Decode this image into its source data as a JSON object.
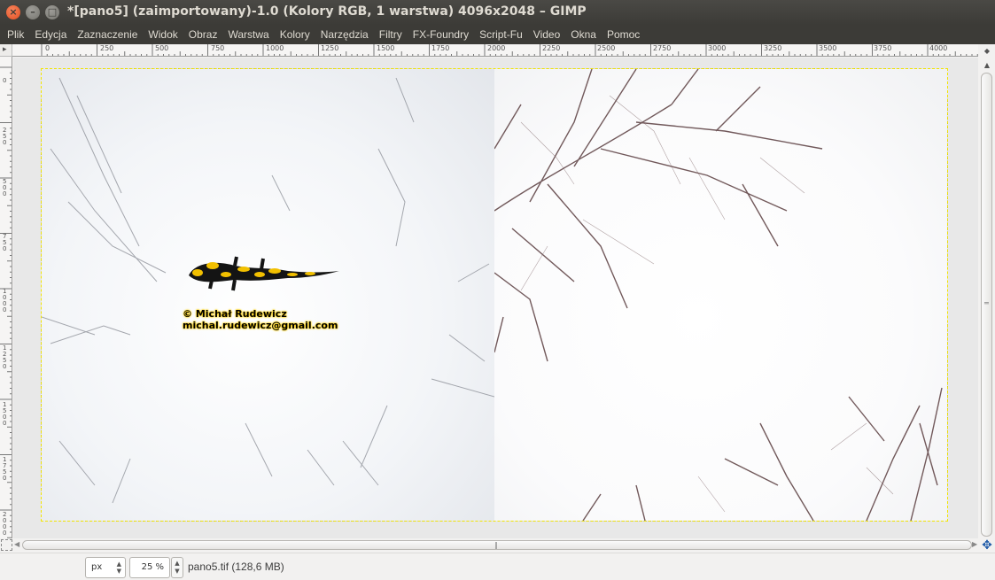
{
  "window": {
    "title": "*[pano5] (zaimportowany)-1.0 (Kolory RGB, 1 warstwa) 4096x2048 – GIMP",
    "close_icon": "close-icon",
    "minimize_icon": "minimize-icon",
    "maximize_icon": "maximize-icon"
  },
  "menu": [
    "Plik",
    "Edycja",
    "Zaznaczenie",
    "Widok",
    "Obraz",
    "Warstwa",
    "Kolory",
    "Narzędzia",
    "Filtry",
    "FX-Foundry",
    "Script-Fu",
    "Video",
    "Okna",
    "Pomoc"
  ],
  "rulers": {
    "horizontal": [
      "0",
      "250",
      "500",
      "750",
      "1000",
      "1250",
      "1500",
      "1750",
      "2000",
      "2250",
      "2500",
      "2750",
      "3000",
      "3250",
      "3500",
      "3750",
      "4000"
    ],
    "vertical": [
      "0",
      "250",
      "500",
      "750",
      "1000",
      "1250",
      "1500",
      "1750",
      "2000"
    ]
  },
  "image": {
    "watermark_line1": "© Michał Rudewicz",
    "watermark_line2": "michal.rudewicz@gmail.com"
  },
  "status": {
    "unit": "px",
    "zoom": "25 %",
    "file_info": "pano5.tif (128,6 MB)"
  },
  "colors": {
    "titlebar": "#3c3b37",
    "close_button": "#e14f22",
    "selection_dash": "#f3e600",
    "watermark_glow": "#ffd000"
  }
}
